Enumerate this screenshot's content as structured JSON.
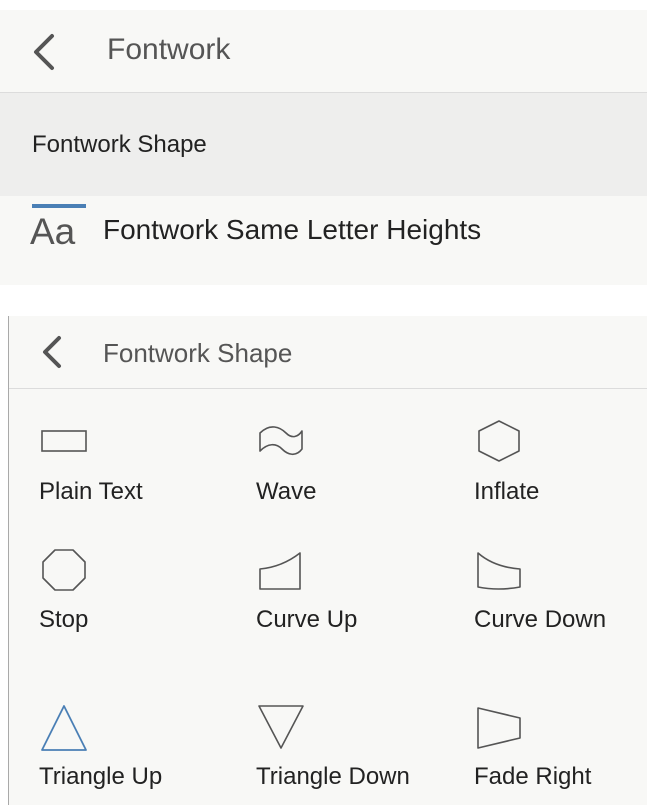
{
  "top_panel": {
    "header": {
      "back_icon": "chevron-left-icon",
      "title": "Fontwork"
    },
    "items": [
      {
        "label": "Fontwork Shape"
      },
      {
        "icon": "same-letter-heights-icon",
        "icon_text": "Aa",
        "label": "Fontwork Same Letter Heights"
      }
    ]
  },
  "bottom_panel": {
    "header": {
      "back_icon": "chevron-left-icon",
      "title": "Fontwork Shape"
    },
    "shapes": [
      {
        "icon": "plain-text-icon",
        "label": "Plain Text"
      },
      {
        "icon": "wave-icon",
        "label": "Wave"
      },
      {
        "icon": "inflate-icon",
        "label": "Inflate"
      },
      {
        "icon": "stop-icon",
        "label": "Stop"
      },
      {
        "icon": "curve-up-icon",
        "label": "Curve Up"
      },
      {
        "icon": "curve-down-icon",
        "label": "Curve Down"
      },
      {
        "icon": "triangle-up-icon",
        "label": "Triangle Up"
      },
      {
        "icon": "triangle-down-icon",
        "label": "Triangle Down"
      },
      {
        "icon": "fade-right-icon",
        "label": "Fade Right"
      }
    ]
  },
  "colors": {
    "panel_background": "#f8f8f6",
    "selected_row": "#eeeeed",
    "accent_blue": "#4a7fb5",
    "icon_gray": "#555555",
    "text": "#222222",
    "divider": "#dcdcdc"
  }
}
